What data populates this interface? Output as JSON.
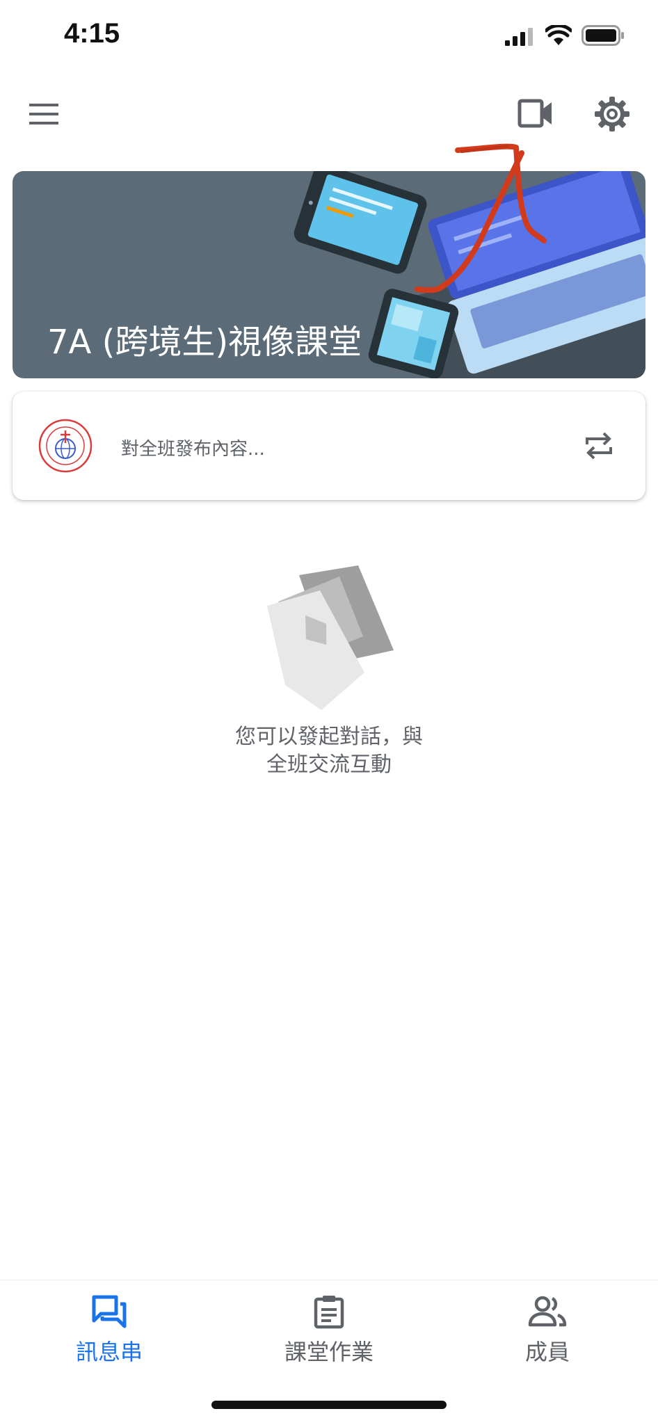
{
  "status_bar": {
    "time": "4:15"
  },
  "course": {
    "title": "7A (跨境生)視像課堂"
  },
  "post_box": {
    "placeholder": "對全班發布內容..."
  },
  "empty_state": {
    "line1": "您可以發起對話，與",
    "line2": "全班交流互動"
  },
  "bottom_nav": {
    "items": [
      {
        "label": "訊息串",
        "icon": "stream-icon",
        "active": true
      },
      {
        "label": "課堂作業",
        "icon": "classwork-icon",
        "active": false
      },
      {
        "label": "成員",
        "icon": "people-icon",
        "active": false
      }
    ]
  },
  "icons": {
    "menu": "menu-icon",
    "video": "video-camera-icon",
    "settings": "gear-icon",
    "repost": "repeat-icon"
  },
  "colors": {
    "banner": "#5b6b78",
    "accent": "#1a73e8",
    "active_nav": "#1a73e8",
    "inactive_nav": "#5f6368",
    "annotation": "#d23a1c"
  }
}
